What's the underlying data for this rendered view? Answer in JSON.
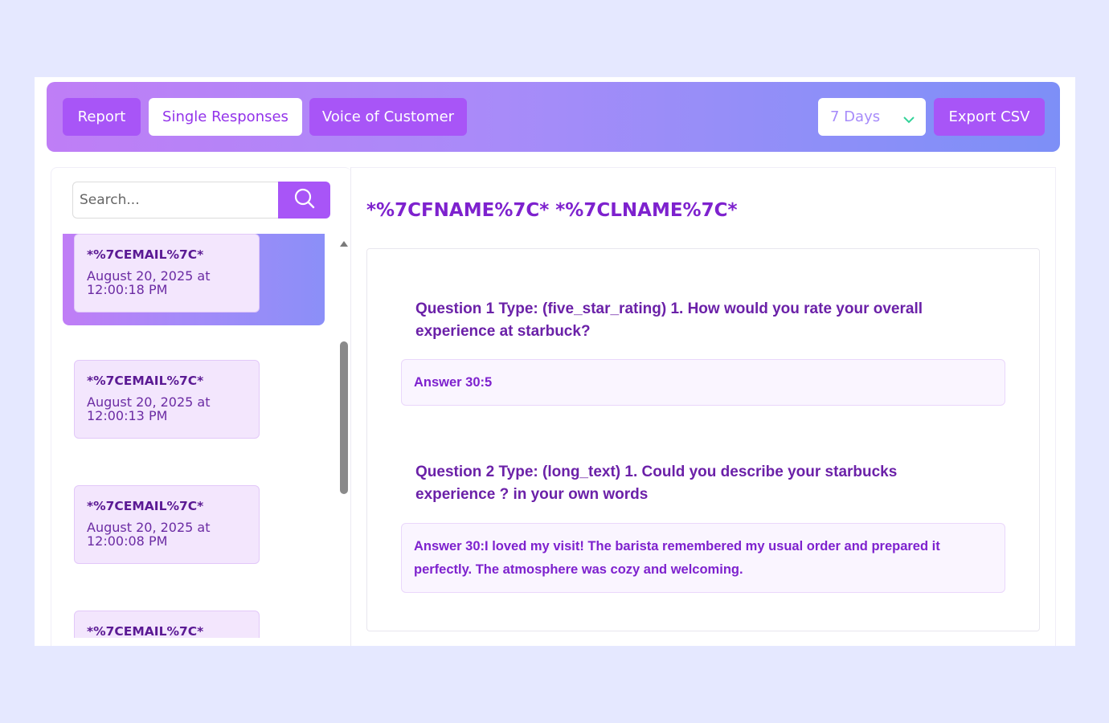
{
  "toolbar": {
    "tabs": [
      {
        "label": "Report"
      },
      {
        "label": "Single Responses"
      },
      {
        "label": "Voice of Customer"
      }
    ],
    "range_select": {
      "value": "7 Days"
    },
    "export_label": "Export CSV"
  },
  "search": {
    "placeholder": "Search..."
  },
  "responses": [
    {
      "email": "*%7CEMAIL%7C*",
      "date": "August 20, 2025 at 12:00:18 PM",
      "selected": true
    },
    {
      "email": "*%7CEMAIL%7C*",
      "date": "August 20, 2025 at 12:00:13 PM"
    },
    {
      "email": "*%7CEMAIL%7C*",
      "date": "August 20, 2025 at 12:00:08 PM"
    },
    {
      "email": "*%7CEMAIL%7C*",
      "date": ""
    }
  ],
  "detail": {
    "name": "*%7CFNAME%7C* *%7CLNAME%7C*",
    "questions": [
      {
        "question": "Question 1 Type: (five_star_rating) 1. How would you rate your overall experience at starbuck?",
        "answer": "Answer 30:5"
      },
      {
        "question": "Question 2 Type: (long_text) 1. Could you describe your starbucks experience ? in your own words",
        "answer": "Answer 30:I loved my visit! The barista remembered my usual order and prepared it perfectly. The atmosphere was cozy and welcoming."
      }
    ]
  },
  "colors": {
    "accent": "#a855f7",
    "title": "#7e22ce",
    "background": "#e5e8ff"
  },
  "icons": [
    "search-icon",
    "chevron-down-icon",
    "scroll-up-arrow-icon"
  ]
}
